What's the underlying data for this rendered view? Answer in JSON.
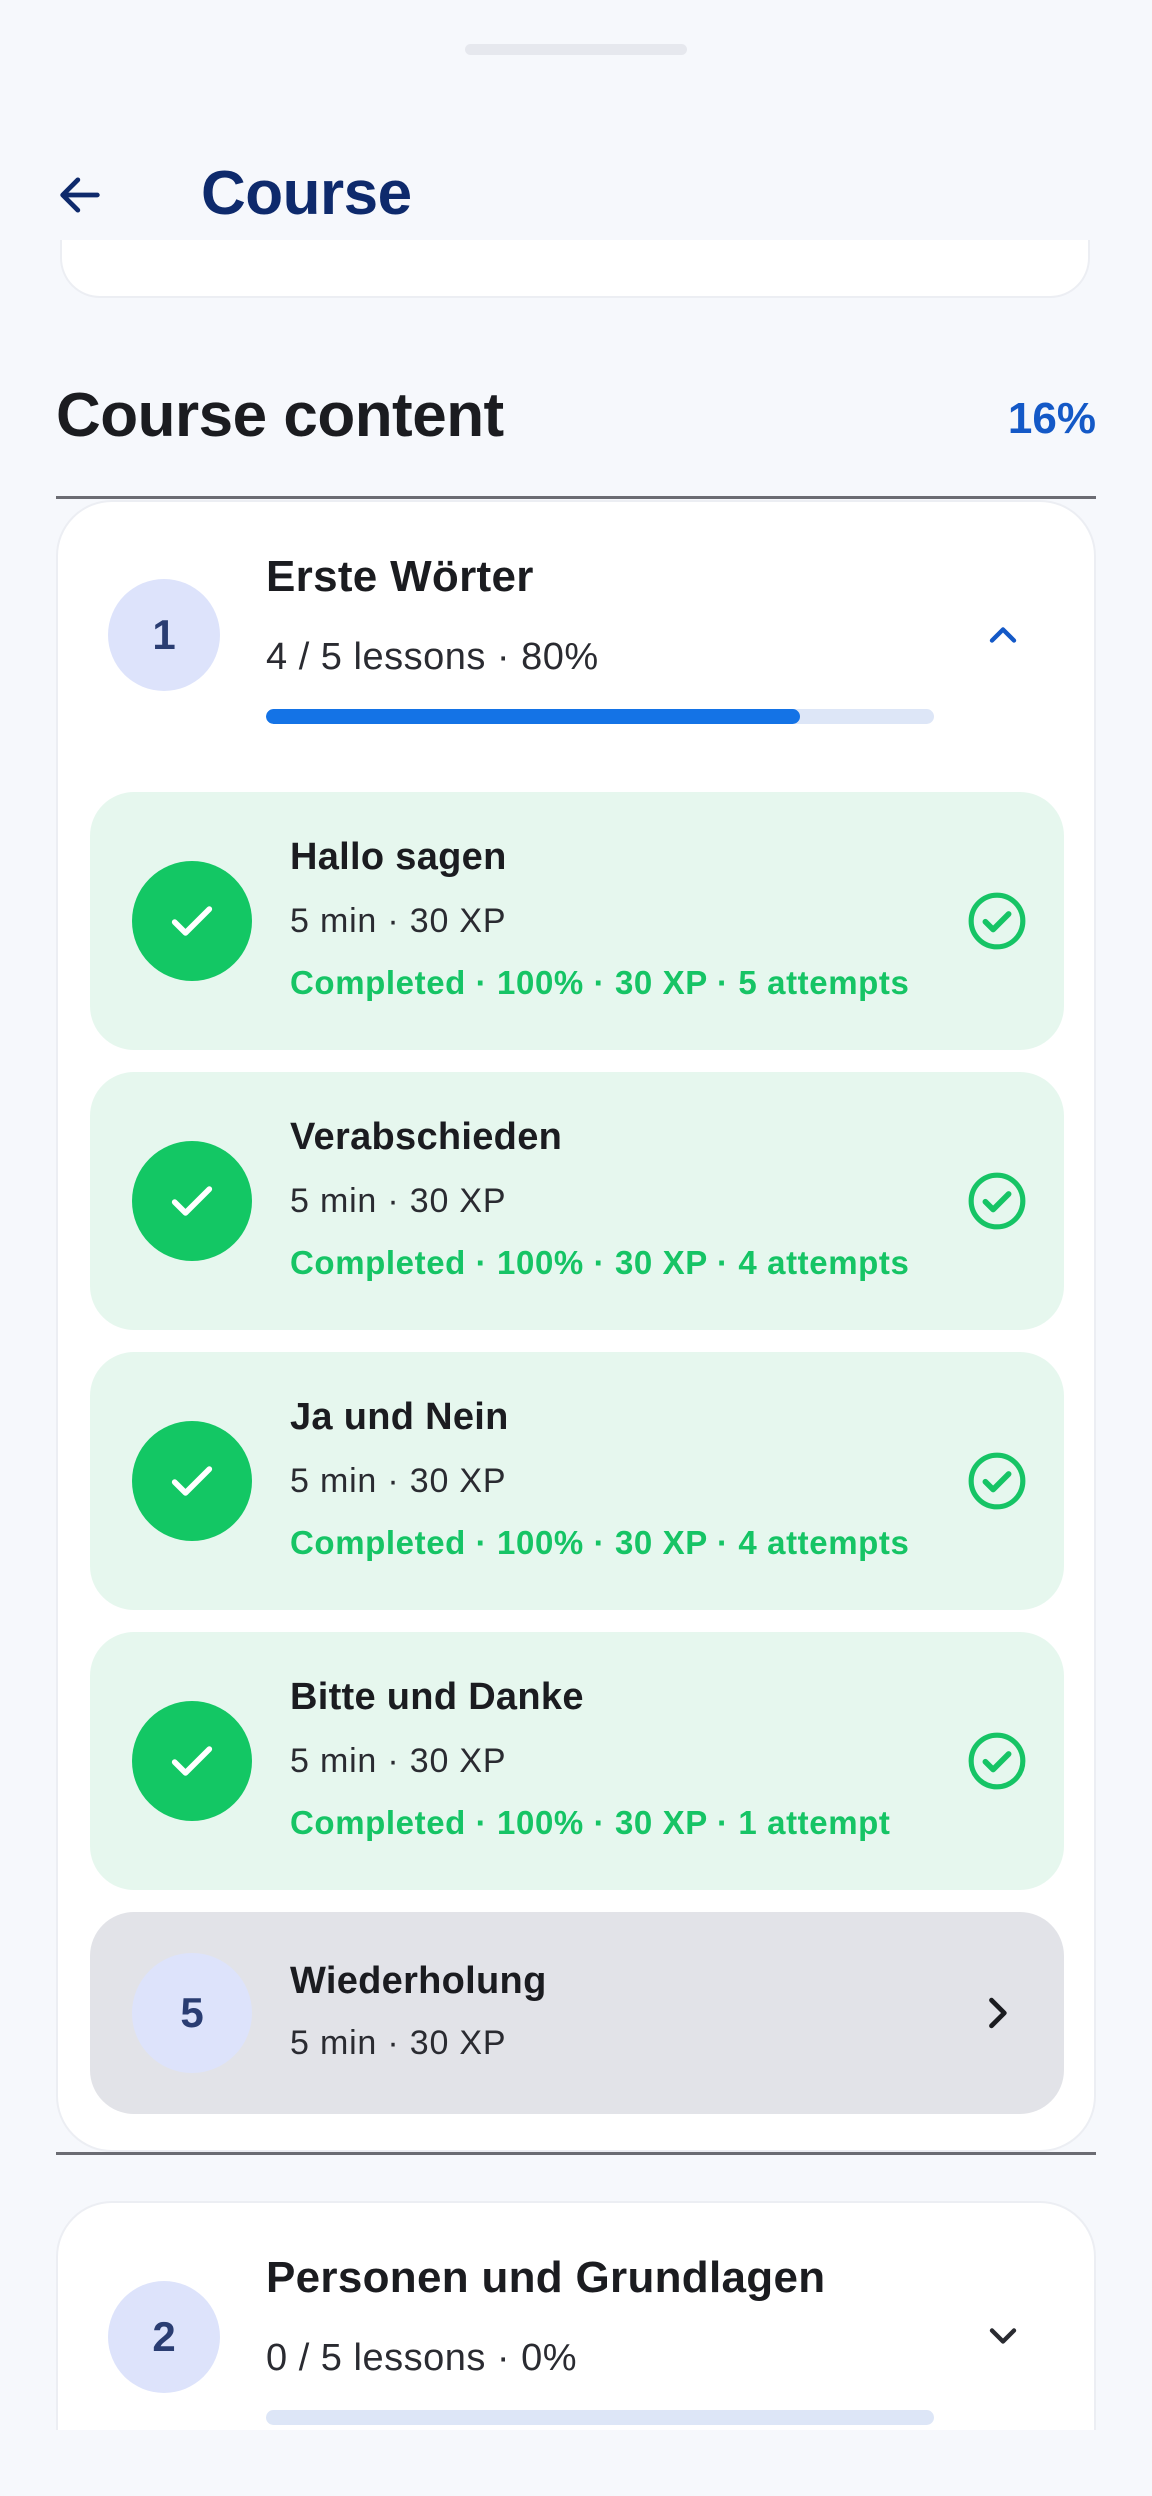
{
  "header": {
    "title": "Course",
    "back_icon": "arrow-left-icon"
  },
  "section": {
    "title": "Course content",
    "percent": "16%"
  },
  "modules": [
    {
      "number": "1",
      "title": "Erste Wörter",
      "summary": "4 / 5 lessons · 80%",
      "progress": 0.8,
      "expanded": true,
      "toggle_icon": "chevron-up-icon",
      "lessons": [
        {
          "title": "Hallo sagen",
          "meta": "5 min · 30 XP",
          "status": "Completed · 100% · 30 XP · 5 attempts",
          "state": "completed"
        },
        {
          "title": "Verabschieden",
          "meta": "5 min · 30 XP",
          "status": "Completed · 100% · 30 XP · 4 attempts",
          "state": "completed"
        },
        {
          "title": "Ja und Nein",
          "meta": "5 min · 30 XP",
          "status": "Completed · 100% · 30 XP · 4 attempts",
          "state": "completed"
        },
        {
          "title": "Bitte und Danke",
          "meta": "5 min · 30 XP",
          "status": "Completed · 100% · 30 XP · 1 attempt",
          "state": "completed"
        },
        {
          "number": "5",
          "title": "Wiederholung",
          "meta": "5 min · 30 XP",
          "state": "available"
        }
      ]
    },
    {
      "number": "2",
      "title": "Personen und Grundlagen",
      "summary": "0 / 5 lessons · 0%",
      "progress": 0,
      "expanded": false,
      "toggle_icon": "chevron-down-icon"
    }
  ],
  "colors": {
    "primary": "#0e2a6c",
    "accent": "#1459c7",
    "progress": "#1473e6",
    "success": "#13c764",
    "success_bg": "#e6f7ee"
  }
}
